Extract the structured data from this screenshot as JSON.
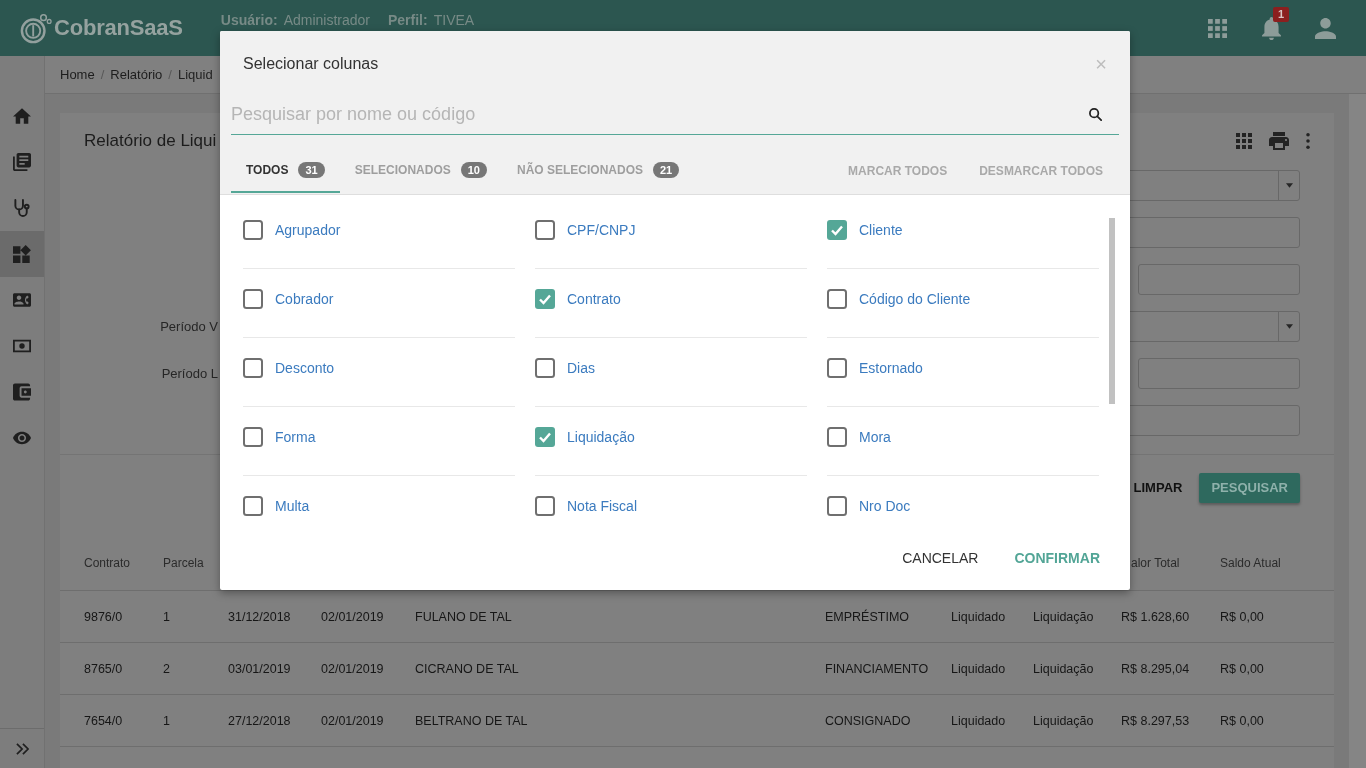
{
  "topbar": {
    "logo": "CobranSaaS",
    "user_label": "Usuário:",
    "user": "Administrador",
    "profile_label": "Perfil:",
    "profile": "TIVEA",
    "notification_count": "1"
  },
  "sidebar": {
    "items": [
      {
        "selected": false
      },
      {
        "selected": false
      },
      {
        "selected": false
      },
      {
        "selected": true
      },
      {
        "selected": false
      },
      {
        "selected": false
      },
      {
        "selected": false
      },
      {
        "selected": false
      }
    ]
  },
  "breadcrumb": {
    "separator": "/",
    "items": [
      "Home",
      "Relatório",
      "Liquid"
    ]
  },
  "report": {
    "title": "Relatório de Liqui",
    "filters": [
      {
        "kind": "select"
      },
      {
        "kind": "text"
      },
      {
        "kind": "short"
      },
      {
        "kind": "select",
        "label": "Período V"
      },
      {
        "kind": "short",
        "label": "Período L"
      },
      {
        "kind": "text"
      }
    ],
    "buttons": [
      {
        "label": "LIMPAR",
        "kind": "flat"
      },
      {
        "label": "PESQUISAR",
        "kind": "raised"
      }
    ],
    "table": {
      "columns_left": [
        "Contrato",
        "Parcela"
      ],
      "columns_right": [
        "alor Total",
        "Saldo Atual"
      ],
      "rows": [
        [
          "9876/0",
          "1",
          "31/12/2018",
          "02/01/2019",
          "FULANO DE TAL",
          "EMPRÉSTIMO",
          "Liquidado",
          "Liquidação",
          "R$ 1.628,60",
          "R$ 0,00"
        ],
        [
          "8765/0",
          "2",
          "03/01/2019",
          "02/01/2019",
          "CICRANO DE TAL",
          "FINANCIAMENTO",
          "Liquidado",
          "Liquidação",
          "R$ 8.295,04",
          "R$ 0,00"
        ],
        [
          "7654/0",
          "1",
          "27/12/2018",
          "02/01/2019",
          "BELTRANO DE TAL",
          "CONSIGNADO",
          "Liquidado",
          "Liquidação",
          "R$ 8.297,53",
          "R$ 0,00"
        ]
      ]
    }
  },
  "dialog": {
    "title": "Selecionar colunas",
    "close": "×",
    "search": {
      "placeholder": "Pesquisar por nome ou código"
    },
    "tabs": [
      {
        "label": "TODOS",
        "count": "31",
        "selected": true
      },
      {
        "label": "SELECIONADOS",
        "count": "10",
        "selected": false
      },
      {
        "label": "NÃO SELECIONADOS",
        "count": "21",
        "selected": false
      }
    ],
    "actions": [
      "MARCAR TODOS",
      "DESMARCAR TODOS"
    ],
    "columns": [
      {
        "label": "Agrupador",
        "checked": false
      },
      {
        "label": "CPF/CNPJ",
        "checked": false
      },
      {
        "label": "Cliente",
        "checked": true
      },
      {
        "label": "Cobrador",
        "checked": false
      },
      {
        "label": "Contrato",
        "checked": true
      },
      {
        "label": "Código do Cliente",
        "checked": false
      },
      {
        "label": "Desconto",
        "checked": false
      },
      {
        "label": "Dias",
        "checked": false
      },
      {
        "label": "Estornado",
        "checked": false
      },
      {
        "label": "Forma",
        "checked": false
      },
      {
        "label": "Liquidação",
        "checked": true
      },
      {
        "label": "Mora",
        "checked": false
      },
      {
        "label": "Multa",
        "checked": false
      },
      {
        "label": "Nota Fiscal",
        "checked": false
      },
      {
        "label": "Nro Doc",
        "checked": false
      }
    ],
    "buttons": [
      {
        "label": "CANCELAR",
        "kind": "secondary"
      },
      {
        "label": "CONFIRMAR",
        "kind": "primary"
      }
    ]
  }
}
